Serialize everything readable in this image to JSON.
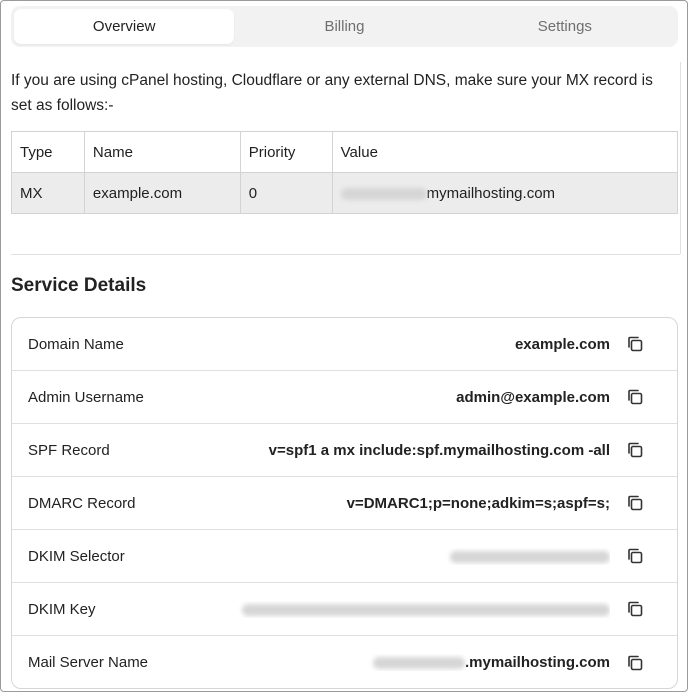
{
  "tabs": [
    {
      "label": "Overview",
      "active": true
    },
    {
      "label": "Billing",
      "active": false
    },
    {
      "label": "Settings",
      "active": false
    }
  ],
  "intro": "If you are using cPanel hosting, Cloudflare or any external DNS, make sure your MX record is set as follows:-",
  "dns_table": {
    "headers": [
      "Type",
      "Name",
      "Priority",
      "Value"
    ],
    "row": {
      "type": "MX",
      "name": "example.com",
      "priority": "0",
      "value_suffix": "mymailhosting.com"
    }
  },
  "section_title": "Service Details",
  "details": [
    {
      "label": "Domain Name",
      "value": "example.com"
    },
    {
      "label": "Admin Username",
      "value": "admin@example.com"
    },
    {
      "label": "SPF Record",
      "value": "v=spf1 a mx include:spf.mymailhosting.com -all"
    },
    {
      "label": "DMARC Record",
      "value": "v=DMARC1;p=none;adkim=s;aspf=s;"
    },
    {
      "label": "DKIM Selector",
      "value": ""
    },
    {
      "label": "DKIM Key",
      "value": ""
    },
    {
      "label": "Mail Server Name",
      "value": ".mymailhosting.com"
    }
  ],
  "icons": {
    "copy": "copy-icon"
  },
  "colors": {
    "tab_bg": "#f2f2f2",
    "row_highlight": "#ececec",
    "border": "#d6d6d6"
  }
}
